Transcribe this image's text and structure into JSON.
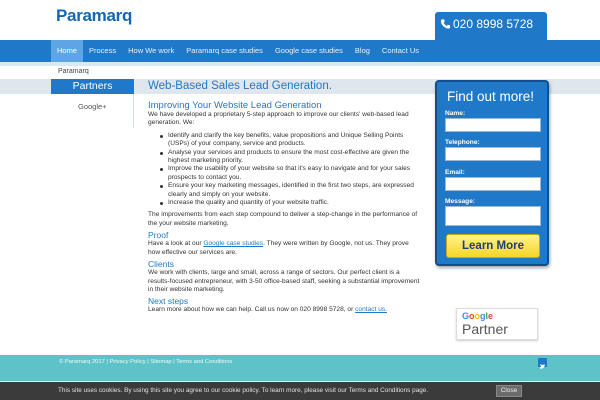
{
  "header": {
    "logo": "Paramarq",
    "phone": "020 8998 5728"
  },
  "nav": {
    "items": [
      "Home",
      "Process",
      "How We work",
      "Paramarq case studies",
      "Google case studies",
      "Blog",
      "Contact Us"
    ],
    "active": "Home"
  },
  "breadcrumb": "Paramarq",
  "sidebar": {
    "title": "Partners",
    "logo": "Google+"
  },
  "main": {
    "title": "Web-Based Sales Lead Generation.",
    "heading": "Improving Your Website Lead Generation",
    "intro": "We have developed a proprietary 5-step approach to improve our clients' web-based lead generation. We:",
    "bullets": [
      "Identify and clarify the key benefits, value propositions and Unique Selling Points (USPs) of your company, service and products.",
      "Analyse your services and products to ensure the most cost-effective are given the highest marketing priority.",
      "Improve the usability of your website so that it's easy to navigate and for your sales prospects to contact you.",
      "Ensure your key marketing messages, identified in the first two steps, are expressed clearly and simply on your website.",
      "Increase the quality and quantity of your website traffic."
    ],
    "summary": "The improvements from each step compound to deliver a step-change in the performance of the your website marketing.",
    "proof_heading": "Proof",
    "proof_text_before": "Have a look at our ",
    "proof_link": "Google case studies",
    "proof_text_after": ". They were written by Google, not us. They prove how effective our services are.",
    "clients_heading": "Clients",
    "clients_text": "We work with clients, large and small, across a range of sectors. Our perfect client is a results-focused entrepreneur, with 3-50 office-based staff, seeking a substantial improvement in their website marketing.",
    "next_heading": "Next steps",
    "next_text_before": "Learn more about how we can help. Call us now on 020 8998 5728, or ",
    "next_link": "contact us.",
    "next_text_after": ""
  },
  "form": {
    "title": "Find out more!",
    "name_label": "Name:",
    "phone_label": "Telephone:",
    "email_label": "Email:",
    "message_label": "Message:",
    "submit": "Learn More"
  },
  "badge": {
    "google": "Google",
    "partner": "Partner"
  },
  "footer": {
    "links": "© Paramarq 2017 | Privacy Policy | Sitemap | Terms and Conditions"
  },
  "cookie": {
    "text": "This site uses cookies. By using this site you agree to our cookie policy. To learn more, please visit our Terms and Conditions page.",
    "close": "Close"
  },
  "colors": {
    "brand_blue": "#1f78c8",
    "footer_teal": "#5ec3c9",
    "button_yellow": "#f5d52a"
  }
}
